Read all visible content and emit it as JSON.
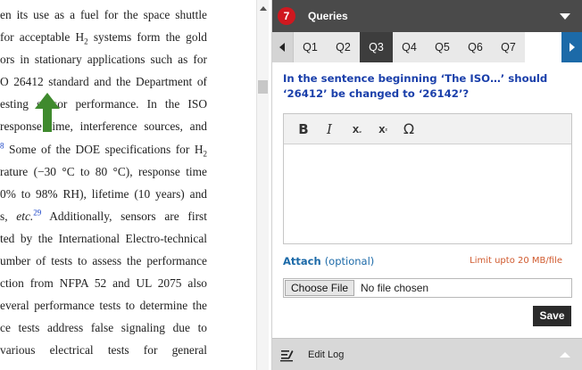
{
  "document": {
    "lines": [
      {
        "pre": "en its use as a fuel for the space shuttle"
      },
      {
        "pre": "for acceptable H",
        "sub": "2",
        "post": " systems form the gold"
      },
      {
        "pre": "ors in stationary applications such as for"
      },
      {
        "pre": "O 26412 standard and the Department of"
      },
      {
        "pre": "esting  sensor performance. In the ISO"
      },
      {
        "pre": "response time, interference sources, and"
      },
      {
        "sup": "8",
        "pre": " Some of the DOE specifications for H",
        "sub": "2"
      },
      {
        "pre": "rature (−30 °C to 80 °C), response time"
      },
      {
        "pre": "0% to 98% RH), lifetime (10 years) and"
      },
      {
        "pre": "s, ",
        "ital": "etc.",
        "sup": "29",
        "post": " Additionally, sensors are first"
      },
      {
        "pre": "ted by the International Electro-technical"
      },
      {
        "pre": "umber of tests to assess the performance"
      },
      {
        "pre": "ction from NFPA 52 and UL 2075 also"
      },
      {
        "pre": "everal performance tests to determine the"
      },
      {
        "pre": "ce tests address false signaling due to"
      },
      {
        "pre": "  various electrical tests for general"
      }
    ]
  },
  "queries": {
    "count": "7",
    "title": "Queries",
    "tabs": [
      "Q1",
      "Q2",
      "Q3",
      "Q4",
      "Q5",
      "Q6",
      "Q7"
    ],
    "active_tab": "Q3",
    "question": "In the sentence beginning ‘The ISO…’ should ‘26412’ be changed to ‘26142’?",
    "toolbar": {
      "bold": "B",
      "italic": "I",
      "subscript": "x",
      "subscript_mark": "₂",
      "superscript": "x",
      "superscript_mark": "²",
      "special_char": "Ω"
    },
    "attach_label": "Attach",
    "attach_optional": "(optional)",
    "attach_limit": "Limit upto 20 MB/file",
    "file_button": "Choose File",
    "file_status": "No file chosen",
    "save_label": "Save"
  },
  "edit_log": {
    "label": "Edit Log"
  },
  "colors": {
    "header_bg": "#4a4a4a",
    "badge_red": "#d0181f",
    "accent_blue": "#1c6aa8",
    "question_blue": "#1a3faa",
    "arrow_green": "#3f8a2e",
    "limit_orange": "#d05a2e",
    "reference_blue": "#1d46c8"
  }
}
